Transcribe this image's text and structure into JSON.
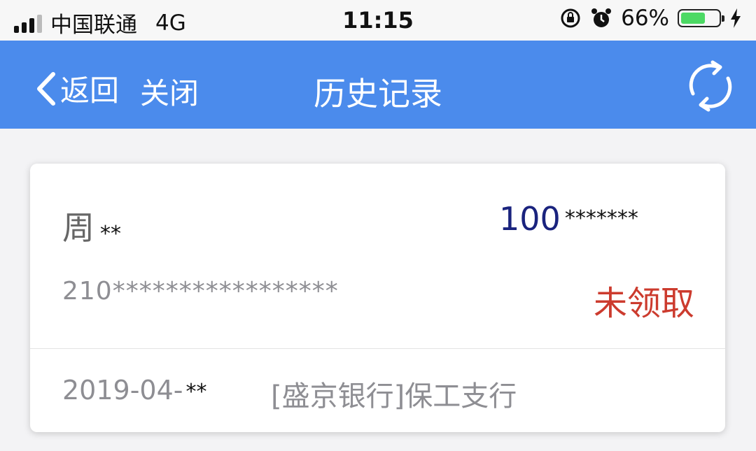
{
  "status_bar": {
    "carrier": "中国联通",
    "network": "4G",
    "time": "11:15",
    "battery_percent": "66%",
    "battery_level": 0.66,
    "icons": [
      "signal-icon",
      "orientation-lock-icon",
      "alarm-icon",
      "battery-icon",
      "charging-icon"
    ]
  },
  "navbar": {
    "back_label": "返回",
    "close_label": "关闭",
    "title": "历史记录",
    "refresh_icon": "refresh-icon",
    "color": "#4b8bec"
  },
  "record": {
    "name": "周",
    "name_mask": "**",
    "amount": "100",
    "amount_mask": "*******",
    "id_number": "210*****************",
    "status": "未领取",
    "status_color": "#cc3b2e",
    "date": "2019-04-",
    "date_mask": "**",
    "bank": "[盛京银行]保工支行"
  }
}
